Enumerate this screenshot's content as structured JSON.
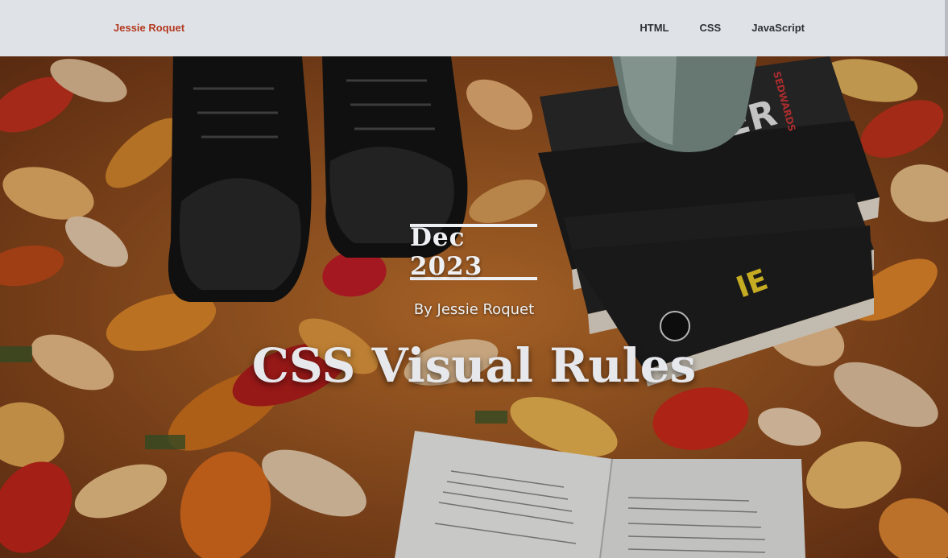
{
  "nav": {
    "brand": "Jessie Roquet",
    "links": [
      "HTML",
      "CSS",
      "JavaScript"
    ]
  },
  "hero": {
    "date": "Dec 2023",
    "byline": "By Jessie Roquet",
    "title": "CSS Visual Rules",
    "image_description_icon": "autumn-leaves-books-boots-photo"
  },
  "colors": {
    "brand": "#b3391f",
    "nav_bg": "#dfe3e8",
    "nav_text": "#2d3136",
    "hero_text": "#eef0f3"
  }
}
